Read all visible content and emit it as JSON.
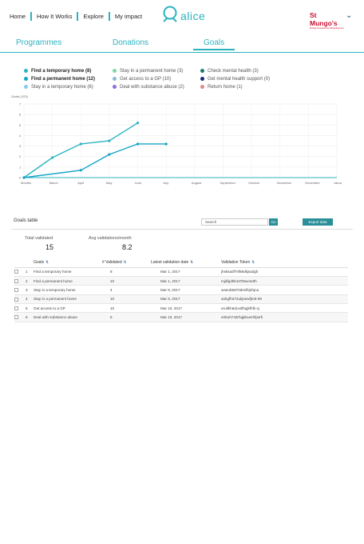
{
  "nav": {
    "items": [
      "Home",
      "How It Works",
      "Explore",
      "My impact"
    ]
  },
  "logo": {
    "text": "alice"
  },
  "brand": {
    "name": "St Mungo's",
    "tagline": "Ending homelessness Rebuilding lives"
  },
  "tabs": [
    "Programmes",
    "Donations",
    "Goals"
  ],
  "active_tab": "Goals",
  "legend": {
    "col1": [
      {
        "label": "Find a temporary home (8)",
        "color": "#2bb3c0",
        "bold": true
      },
      {
        "label": "Find a permanent home (12)",
        "color": "#13a3c7",
        "bold": true
      },
      {
        "label": "Stay in a temporary home (6)",
        "color": "#87c9ee",
        "bold": false
      }
    ],
    "col2": [
      {
        "label": "Stay in a permanent home (3)",
        "color": "#7ed99b",
        "bold": false
      },
      {
        "label": "Get access to a GP (10)",
        "color": "#8bb8d9",
        "bold": false
      },
      {
        "label": "Deal with substance abuse (2)",
        "color": "#8a6fe0",
        "bold": false
      }
    ],
    "col3": [
      {
        "label": "Check mental health (3)",
        "color": "#1e7a6c",
        "bold": false
      },
      {
        "label": "Get mental health support (0)",
        "color": "#1b2b7a",
        "bold": false
      },
      {
        "label": "Return home (1)",
        "color": "#e08a8a",
        "bold": false
      }
    ]
  },
  "chart_data": {
    "type": "line",
    "title": "",
    "ylabel": "Goals (103)",
    "xlabel": "",
    "categories": [
      "Months",
      "March",
      "April",
      "May",
      "June",
      "July",
      "August",
      "September",
      "October",
      "November",
      "December",
      "January"
    ],
    "ylim": [
      0,
      7
    ],
    "yticks": [
      0,
      1,
      2,
      3,
      4,
      5,
      6,
      7
    ],
    "series": [
      {
        "color": "#2bb3c0",
        "values": [
          0,
          1.9,
          3.2,
          3.5,
          5.2,
          null,
          null,
          null,
          null,
          null,
          null,
          null
        ]
      },
      {
        "color": "#13a3c7",
        "values": [
          0,
          null,
          0.7,
          2.2,
          3.2,
          3.2,
          null,
          null,
          null,
          null,
          null,
          null
        ]
      }
    ]
  },
  "goals_table": {
    "title": "Goals table",
    "search_placeholder": "Search",
    "go_label": "Go",
    "export_label": "Export data",
    "stats": [
      {
        "label": "Total validated",
        "value": "15"
      },
      {
        "label": "Avg validations/month",
        "value": "8.2"
      }
    ],
    "columns": [
      "Goals",
      "# Validated",
      "Latest validation date",
      "Validation Token"
    ],
    "rows": [
      {
        "n": "1",
        "goal": "Find a temporary home",
        "validated": "8",
        "date": "Mar 1, 2017",
        "token": "jhsksadf7sf68dkjsadgh"
      },
      {
        "n": "2",
        "goal": "Find a permanent home",
        "validated": "10",
        "date": "Mar 1, 2017",
        "token": "mjdfgd0k4378sw4o0h"
      },
      {
        "n": "3",
        "goal": "Stay in a temporary home",
        "validated": "4",
        "date": "Mar 8, 2017",
        "token": "waeub6870dsnfkjnfqnu"
      },
      {
        "n": "4",
        "goal": "Stay in a permanent home",
        "validated": "10",
        "date": "Mar 9, 2017",
        "token": "ankgfh372ukjsewfjm9-09"
      },
      {
        "n": "5",
        "goal": "Get access to a GP",
        "validated": "10",
        "date": "Mar 10, 2017",
        "token": "eruifkh6dcx6fhqjkfhfk sj"
      },
      {
        "n": "6",
        "goal": "Deal with substance abuse",
        "validated": "6",
        "date": "Mar 10, 2017",
        "token": "ertkuh743rhqjkbuerhfpsrfi"
      }
    ]
  }
}
